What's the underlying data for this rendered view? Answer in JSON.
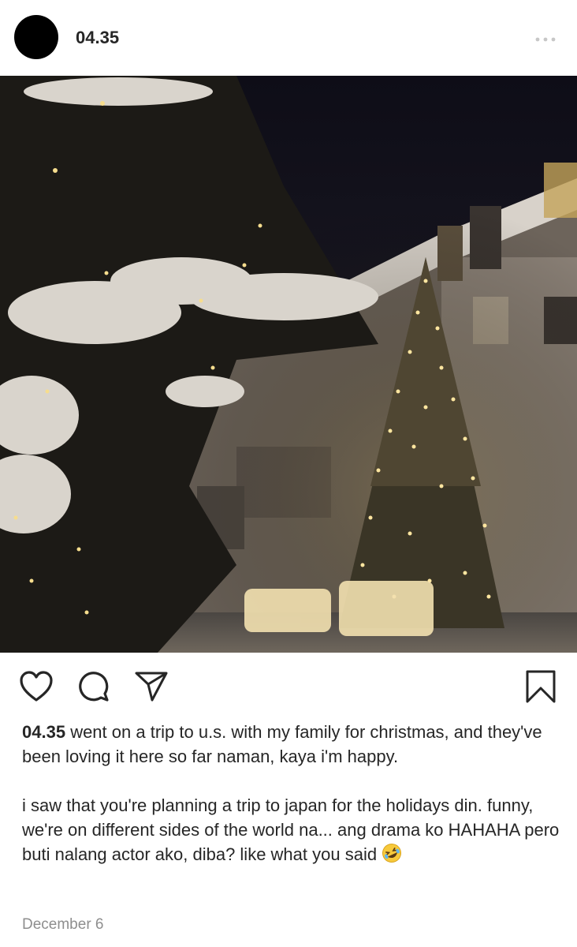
{
  "header": {
    "username": "04.35",
    "more_icon": "more-horizontal-icon"
  },
  "post": {
    "image_icon": "photo",
    "actions": {
      "like_icon": "heart-icon",
      "comment_icon": "comment-icon",
      "share_icon": "send-icon",
      "save_icon": "bookmark-icon"
    },
    "caption": {
      "username": "04.35",
      "paragraph1": "went on a trip to u.s. with my family for christmas, and they've been loving it here so far naman, kaya i'm happy.",
      "paragraph2": "i saw that you're planning a trip to japan for the holidays din. funny, we're on different sides of the world na... ang drama ko HAHAHA pero buti nalang actor ako, diba? like what you said",
      "emoji": "rolling-on-floor-laughing-emoji"
    },
    "date": "December 6"
  },
  "colors": {
    "text": "#262626",
    "secondary": "#8e8e8e",
    "avatar": "#000000"
  }
}
